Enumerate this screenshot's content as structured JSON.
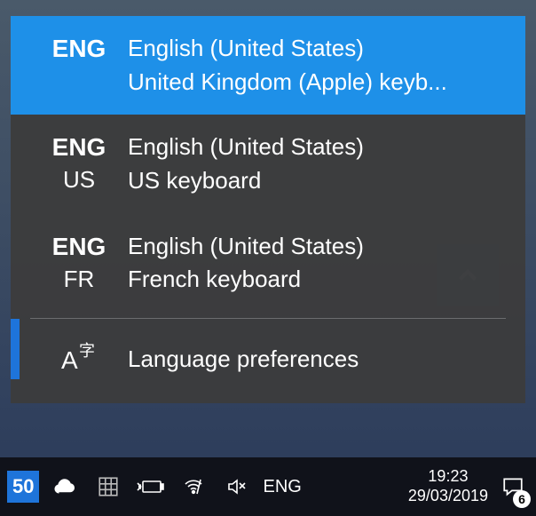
{
  "popup": {
    "items": [
      {
        "abbr": "ENG",
        "sub_abbr": "",
        "name": "English (United States)",
        "layout": "United Kingdom (Apple) keyb...",
        "selected": true
      },
      {
        "abbr": "ENG",
        "sub_abbr": "US",
        "name": "English (United States)",
        "layout": "US keyboard",
        "selected": false
      },
      {
        "abbr": "ENG",
        "sub_abbr": "FR",
        "name": "English (United States)",
        "layout": "French keyboard",
        "selected": false
      }
    ],
    "prefs_label": "Language preferences"
  },
  "taskbar": {
    "battery_badge": "50",
    "lang_indicator": "ENG",
    "clock_time": "19:23",
    "clock_date": "29/03/2019",
    "action_center_badge": "6"
  }
}
